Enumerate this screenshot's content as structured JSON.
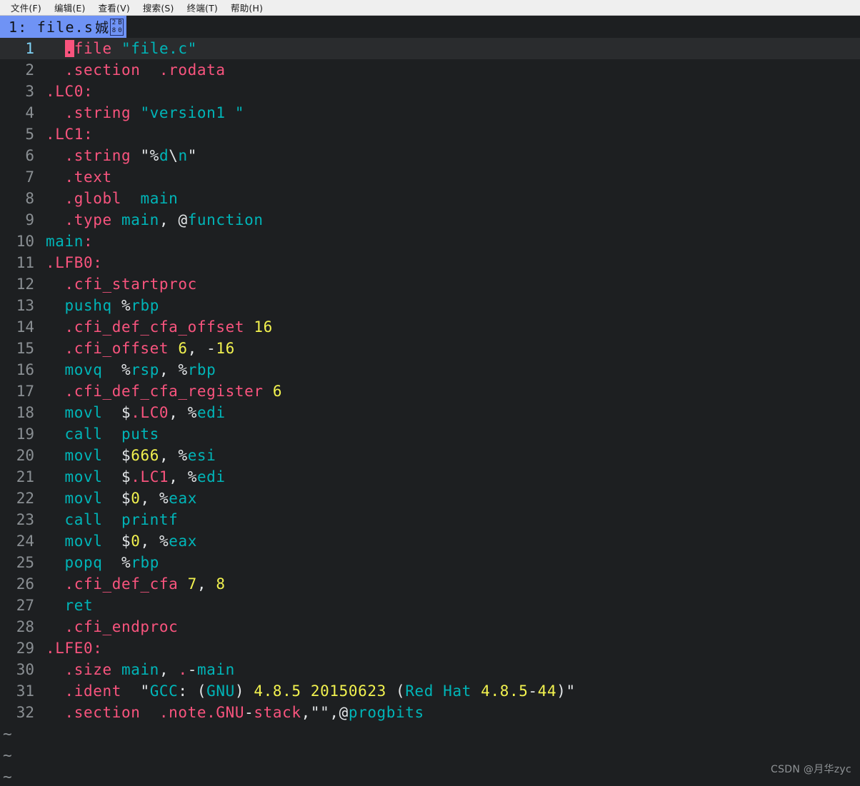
{
  "menubar": {
    "items": [
      {
        "label": "文件(F)",
        "name": "menu-file"
      },
      {
        "label": "编辑(E)",
        "name": "menu-edit"
      },
      {
        "label": "查看(V)",
        "name": "menu-view"
      },
      {
        "label": "搜索(S)",
        "name": "menu-search"
      },
      {
        "label": "终端(T)",
        "name": "menu-terminal"
      },
      {
        "label": "帮助(H)",
        "name": "menu-help"
      }
    ]
  },
  "tabline": {
    "tab_label": "1: file.s",
    "tab_cjk": "娍",
    "tab_missing_glyph": "2B80",
    "missing_glyph_digits": [
      "2",
      "B",
      "8",
      "0"
    ]
  },
  "editor": {
    "current_line": 1,
    "cursor_char": ".",
    "filler_rows": [
      "~",
      "~",
      "~"
    ],
    "lines": [
      {
        "n": "1",
        "tokens": [
          {
            "t": "  ",
            "c": "plain"
          },
          {
            "t": ".",
            "c": "cursor"
          },
          {
            "t": "file ",
            "c": "dir"
          },
          {
            "t": "\"file.c\"",
            "c": "str"
          }
        ]
      },
      {
        "n": "2",
        "tokens": [
          {
            "t": "  .section  .rodata",
            "c": "dir"
          }
        ]
      },
      {
        "n": "3",
        "tokens": [
          {
            "t": ".LC0:",
            "c": "dir"
          }
        ]
      },
      {
        "n": "4",
        "tokens": [
          {
            "t": "  .string ",
            "c": "dir"
          },
          {
            "t": "\"version1 \"",
            "c": "str"
          }
        ]
      },
      {
        "n": "5",
        "tokens": [
          {
            "t": ".LC1:",
            "c": "dir"
          }
        ]
      },
      {
        "n": "6",
        "tokens": [
          {
            "t": "  .string ",
            "c": "dir"
          },
          {
            "t": "\"%",
            "c": "plain"
          },
          {
            "t": "d",
            "c": "str"
          },
          {
            "t": "\\",
            "c": "plain"
          },
          {
            "t": "n",
            "c": "str"
          },
          {
            "t": "\"",
            "c": "plain"
          }
        ]
      },
      {
        "n": "7",
        "tokens": [
          {
            "t": "  .text",
            "c": "dir"
          }
        ]
      },
      {
        "n": "8",
        "tokens": [
          {
            "t": "  .globl ",
            "c": "dir"
          },
          {
            "t": " main",
            "c": "str"
          }
        ]
      },
      {
        "n": "9",
        "tokens": [
          {
            "t": "  .type ",
            "c": "dir"
          },
          {
            "t": "main",
            "c": "str"
          },
          {
            "t": ",",
            "c": "plain"
          },
          {
            "t": " ",
            "c": "plain"
          },
          {
            "t": "@",
            "c": "plain"
          },
          {
            "t": "function",
            "c": "str"
          }
        ]
      },
      {
        "n": "10",
        "tokens": [
          {
            "t": "main",
            "c": "str"
          },
          {
            "t": ":",
            "c": "dir"
          }
        ]
      },
      {
        "n": "11",
        "tokens": [
          {
            "t": ".LFB0:",
            "c": "dir"
          }
        ]
      },
      {
        "n": "12",
        "tokens": [
          {
            "t": "  .cfi_startproc",
            "c": "dir"
          }
        ]
      },
      {
        "n": "13",
        "tokens": [
          {
            "t": "  pushq ",
            "c": "str"
          },
          {
            "t": "%",
            "c": "plain"
          },
          {
            "t": "rbp",
            "c": "str"
          }
        ]
      },
      {
        "n": "14",
        "tokens": [
          {
            "t": "  .cfi_def_cfa_offset ",
            "c": "dir"
          },
          {
            "t": "16",
            "c": "num"
          }
        ]
      },
      {
        "n": "15",
        "tokens": [
          {
            "t": "  .cfi_offset ",
            "c": "dir"
          },
          {
            "t": "6",
            "c": "num"
          },
          {
            "t": ", ",
            "c": "plain"
          },
          {
            "t": "-",
            "c": "plain"
          },
          {
            "t": "16",
            "c": "num"
          }
        ]
      },
      {
        "n": "16",
        "tokens": [
          {
            "t": "  movq  ",
            "c": "str"
          },
          {
            "t": "%",
            "c": "plain"
          },
          {
            "t": "rsp",
            "c": "str"
          },
          {
            "t": ", ",
            "c": "plain"
          },
          {
            "t": "%",
            "c": "plain"
          },
          {
            "t": "rbp",
            "c": "str"
          }
        ]
      },
      {
        "n": "17",
        "tokens": [
          {
            "t": "  .cfi_def_cfa_register ",
            "c": "dir"
          },
          {
            "t": "6",
            "c": "num"
          }
        ]
      },
      {
        "n": "18",
        "tokens": [
          {
            "t": "  movl  ",
            "c": "str"
          },
          {
            "t": "$",
            "c": "plain"
          },
          {
            "t": ".LC0",
            "c": "dir"
          },
          {
            "t": ", ",
            "c": "plain"
          },
          {
            "t": "%",
            "c": "plain"
          },
          {
            "t": "edi",
            "c": "str"
          }
        ]
      },
      {
        "n": "19",
        "tokens": [
          {
            "t": "  call  puts",
            "c": "str"
          }
        ]
      },
      {
        "n": "20",
        "tokens": [
          {
            "t": "  movl  ",
            "c": "str"
          },
          {
            "t": "$",
            "c": "plain"
          },
          {
            "t": "666",
            "c": "num"
          },
          {
            "t": ", ",
            "c": "plain"
          },
          {
            "t": "%",
            "c": "plain"
          },
          {
            "t": "esi",
            "c": "str"
          }
        ]
      },
      {
        "n": "21",
        "tokens": [
          {
            "t": "  movl  ",
            "c": "str"
          },
          {
            "t": "$",
            "c": "plain"
          },
          {
            "t": ".LC1",
            "c": "dir"
          },
          {
            "t": ", ",
            "c": "plain"
          },
          {
            "t": "%",
            "c": "plain"
          },
          {
            "t": "edi",
            "c": "str"
          }
        ]
      },
      {
        "n": "22",
        "tokens": [
          {
            "t": "  movl  ",
            "c": "str"
          },
          {
            "t": "$",
            "c": "plain"
          },
          {
            "t": "0",
            "c": "num"
          },
          {
            "t": ", ",
            "c": "plain"
          },
          {
            "t": "%",
            "c": "plain"
          },
          {
            "t": "eax",
            "c": "str"
          }
        ]
      },
      {
        "n": "23",
        "tokens": [
          {
            "t": "  call  printf",
            "c": "str"
          }
        ]
      },
      {
        "n": "24",
        "tokens": [
          {
            "t": "  movl  ",
            "c": "str"
          },
          {
            "t": "$",
            "c": "plain"
          },
          {
            "t": "0",
            "c": "num"
          },
          {
            "t": ", ",
            "c": "plain"
          },
          {
            "t": "%",
            "c": "plain"
          },
          {
            "t": "eax",
            "c": "str"
          }
        ]
      },
      {
        "n": "25",
        "tokens": [
          {
            "t": "  popq  ",
            "c": "str"
          },
          {
            "t": "%",
            "c": "plain"
          },
          {
            "t": "rbp",
            "c": "str"
          }
        ]
      },
      {
        "n": "26",
        "tokens": [
          {
            "t": "  .cfi_def_cfa ",
            "c": "dir"
          },
          {
            "t": "7",
            "c": "num"
          },
          {
            "t": ", ",
            "c": "plain"
          },
          {
            "t": "8",
            "c": "num"
          }
        ]
      },
      {
        "n": "27",
        "tokens": [
          {
            "t": "  ret",
            "c": "str"
          }
        ]
      },
      {
        "n": "28",
        "tokens": [
          {
            "t": "  .cfi_endproc",
            "c": "dir"
          }
        ]
      },
      {
        "n": "29",
        "tokens": [
          {
            "t": ".LFE0:",
            "c": "dir"
          }
        ]
      },
      {
        "n": "30",
        "tokens": [
          {
            "t": "  .size ",
            "c": "dir"
          },
          {
            "t": "main",
            "c": "str"
          },
          {
            "t": ",",
            "c": "plain"
          },
          {
            "t": " ",
            "c": "plain"
          },
          {
            "t": ".",
            "c": "dir"
          },
          {
            "t": "-",
            "c": "plain"
          },
          {
            "t": "main",
            "c": "str"
          }
        ]
      },
      {
        "n": "31",
        "tokens": [
          {
            "t": "  .ident  ",
            "c": "dir"
          },
          {
            "t": "\"",
            "c": "plain"
          },
          {
            "t": "GCC",
            "c": "str"
          },
          {
            "t": ":",
            "c": "plain"
          },
          {
            "t": " (",
            "c": "plain"
          },
          {
            "t": "GNU",
            "c": "str"
          },
          {
            "t": ") ",
            "c": "plain"
          },
          {
            "t": "4.8.5 20150623",
            "c": "num"
          },
          {
            "t": " (",
            "c": "plain"
          },
          {
            "t": "Red Hat",
            "c": "str"
          },
          {
            "t": " ",
            "c": "plain"
          },
          {
            "t": "4.8.5",
            "c": "num"
          },
          {
            "t": "-",
            "c": "plain"
          },
          {
            "t": "44",
            "c": "num"
          },
          {
            "t": ")\"",
            "c": "plain"
          }
        ]
      },
      {
        "n": "32",
        "tokens": [
          {
            "t": "  .section  .note.GNU",
            "c": "dir"
          },
          {
            "t": "-",
            "c": "plain"
          },
          {
            "t": "stack",
            "c": "dir"
          },
          {
            "t": ",",
            "c": "plain"
          },
          {
            "t": "\"\"",
            "c": "plain"
          },
          {
            "t": ",",
            "c": "plain"
          },
          {
            "t": "@",
            "c": "plain"
          },
          {
            "t": "progbits",
            "c": "str"
          }
        ]
      }
    ]
  },
  "watermark": {
    "text": "CSDN @月华zyc"
  }
}
